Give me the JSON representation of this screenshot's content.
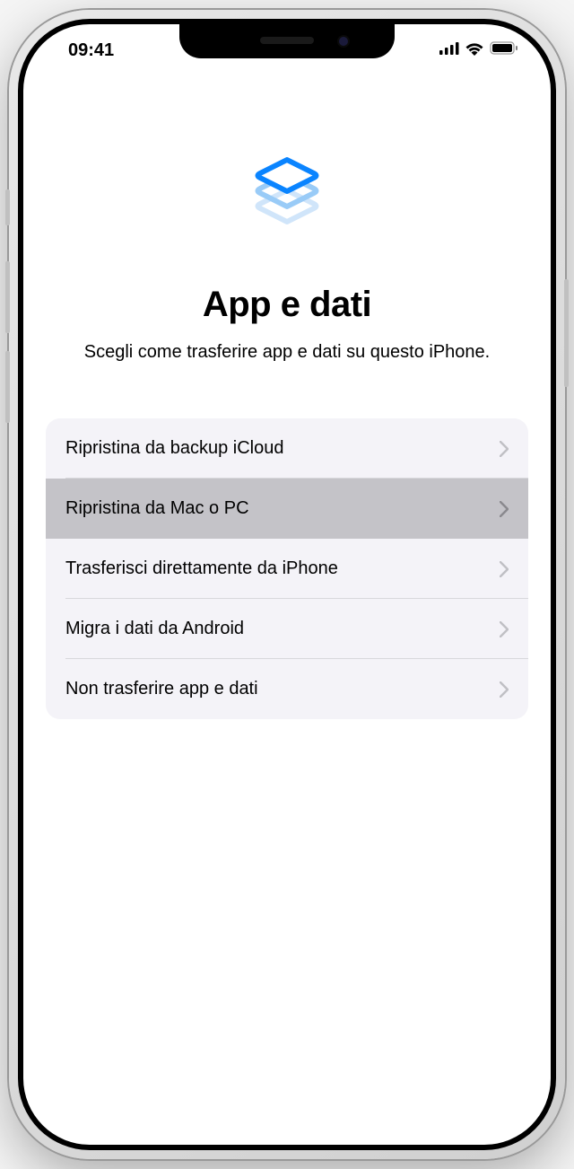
{
  "status": {
    "time": "09:41"
  },
  "screen": {
    "title": "App e dati",
    "subtitle": "Scegli come trasferire app e dati su questo iPhone."
  },
  "options": [
    {
      "label": "Ripristina da backup iCloud",
      "selected": false
    },
    {
      "label": "Ripristina da Mac o PC",
      "selected": true
    },
    {
      "label": "Trasferisci direttamente da iPhone",
      "selected": false
    },
    {
      "label": "Migra i dati da Android",
      "selected": false
    },
    {
      "label": "Non trasferire app e dati",
      "selected": false
    }
  ]
}
